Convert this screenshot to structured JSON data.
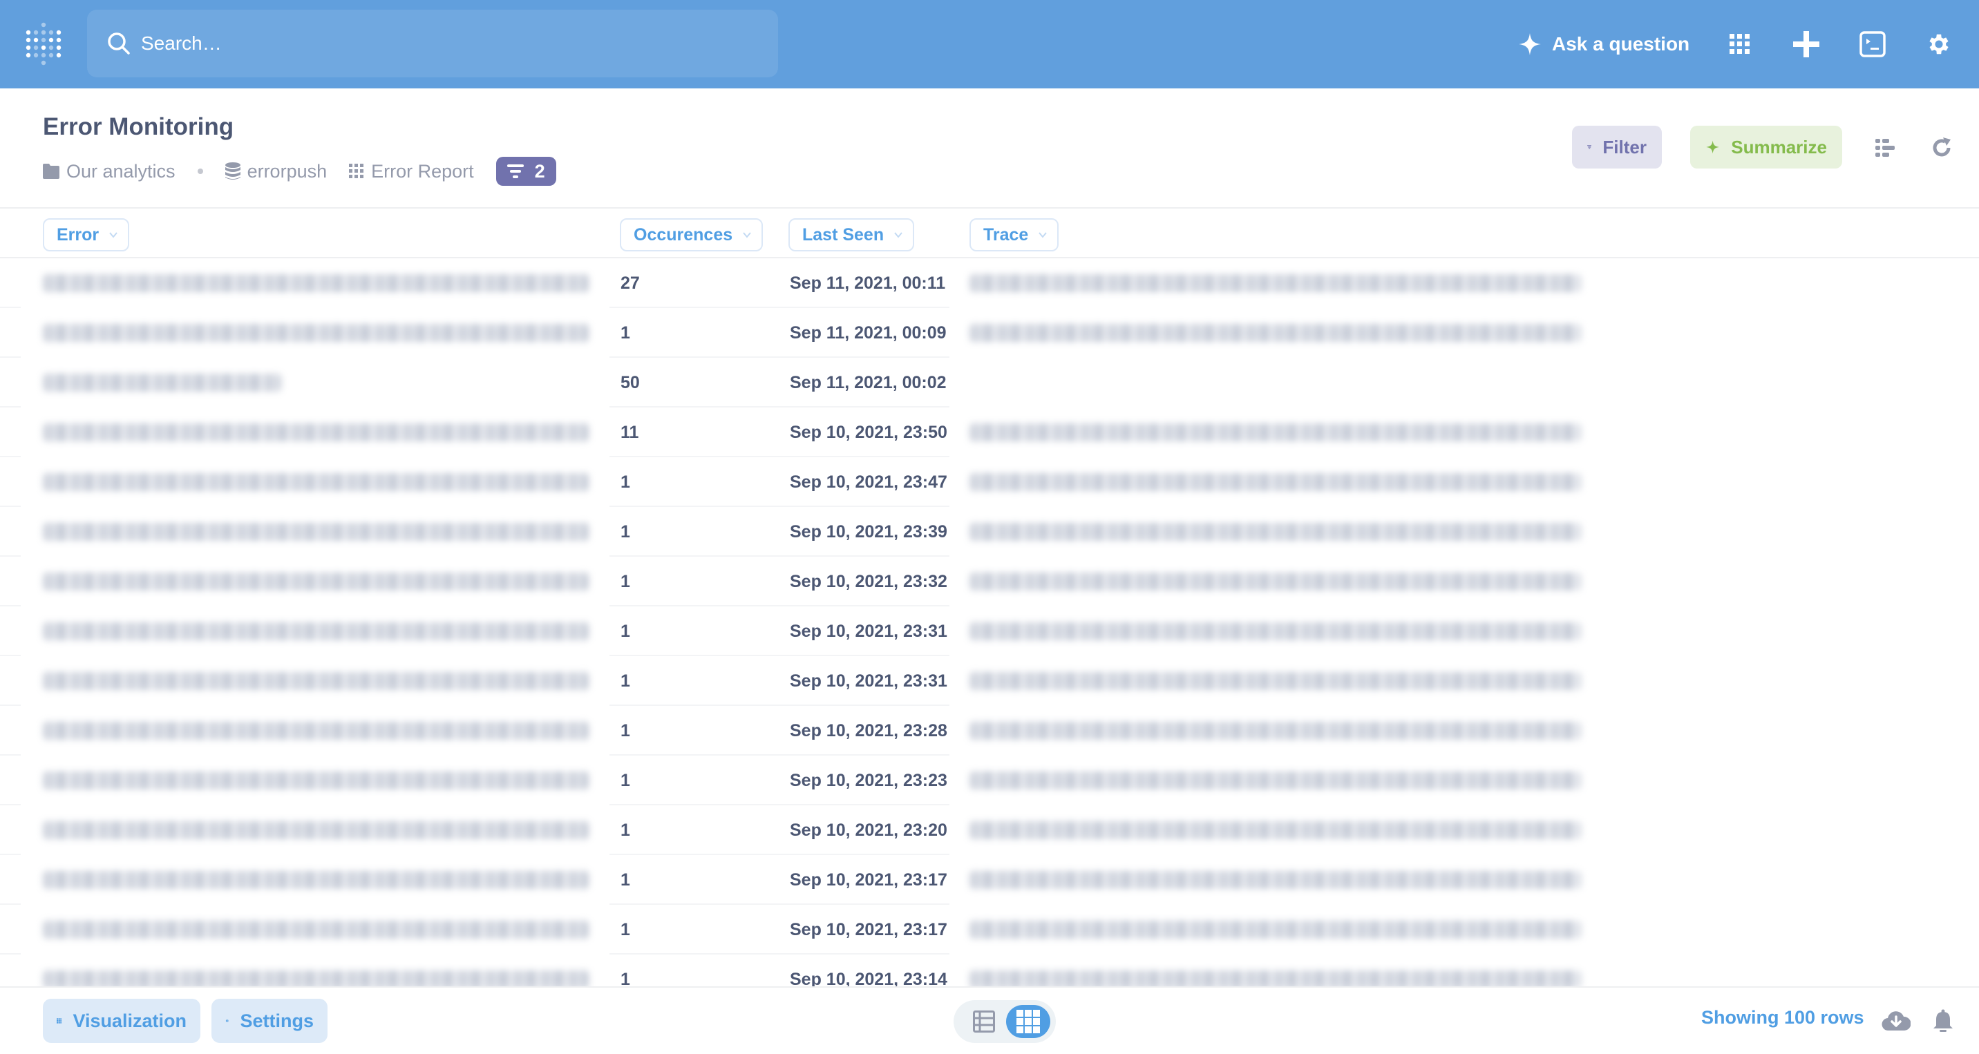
{
  "nav": {
    "logo": "metabase-logo",
    "search_placeholder": "Search…",
    "ask_label": "Ask a question",
    "icons": [
      "apps-grid-icon",
      "plus-icon",
      "terminal-icon",
      "gear-icon"
    ]
  },
  "question": {
    "title": "Error Monitoring",
    "breadcrumbs": [
      {
        "icon": "folder-icon",
        "label": "Our analytics"
      },
      {
        "icon": "database-icon",
        "label": "errorpush"
      },
      {
        "icon": "table-icon",
        "label": "Error Report"
      }
    ],
    "filter_count": "2",
    "filter_label": "Filter",
    "summarize_label": "Summarize"
  },
  "colors": {
    "brand": "#509EE3",
    "nav_bg": "#619FDD",
    "filter": "#7172AD",
    "summarize": "#84BB4C",
    "text": "#4C5773"
  },
  "table": {
    "columns": [
      "Error",
      "Occurences",
      "Last Seen",
      "Trace"
    ],
    "rows": [
      {
        "error": "[redacted]",
        "occurrences": "27",
        "last_seen": "Sep 11, 2021, 00:11",
        "trace": "[redacted]"
      },
      {
        "error": "[redacted]",
        "occurrences": "1",
        "last_seen": "Sep 11, 2021, 00:09",
        "trace": "[redacted]"
      },
      {
        "error": "[redacted]",
        "occurrences": "50",
        "last_seen": "Sep 11, 2021, 00:02",
        "trace": ""
      },
      {
        "error": "[redacted]",
        "occurrences": "11",
        "last_seen": "Sep 10, 2021, 23:50",
        "trace": "[redacted]"
      },
      {
        "error": "[redacted]",
        "occurrences": "1",
        "last_seen": "Sep 10, 2021, 23:47",
        "trace": "[redacted]"
      },
      {
        "error": "[redacted]",
        "occurrences": "1",
        "last_seen": "Sep 10, 2021, 23:39",
        "trace": "[redacted]"
      },
      {
        "error": "[redacted]",
        "occurrences": "1",
        "last_seen": "Sep 10, 2021, 23:32",
        "trace": "[redacted]"
      },
      {
        "error": "[redacted]",
        "occurrences": "1",
        "last_seen": "Sep 10, 2021, 23:31",
        "trace": "[redacted]"
      },
      {
        "error": "[redacted]",
        "occurrences": "1",
        "last_seen": "Sep 10, 2021, 23:31",
        "trace": "[redacted]"
      },
      {
        "error": "[redacted]",
        "occurrences": "1",
        "last_seen": "Sep 10, 2021, 23:28",
        "trace": "[redacted]"
      },
      {
        "error": "[redacted]",
        "occurrences": "1",
        "last_seen": "Sep 10, 2021, 23:23",
        "trace": "[redacted]"
      },
      {
        "error": "[redacted]",
        "occurrences": "1",
        "last_seen": "Sep 10, 2021, 23:20",
        "trace": "[redacted]"
      },
      {
        "error": "[redacted]",
        "occurrences": "1",
        "last_seen": "Sep 10, 2021, 23:17",
        "trace": "[redacted]"
      },
      {
        "error": "[redacted]",
        "occurrences": "1",
        "last_seen": "Sep 10, 2021, 23:17",
        "trace": "[redacted]"
      },
      {
        "error": "[redacted]",
        "occurrences": "1",
        "last_seen": "Sep 10, 2021, 23:14",
        "trace": "[redacted]"
      }
    ]
  },
  "footer": {
    "visualization_label": "Visualization",
    "settings_label": "Settings",
    "view_modes": [
      "table-view-icon",
      "grid-view-icon"
    ],
    "active_view": "grid-view-icon",
    "row_count": "Showing 100 rows"
  }
}
